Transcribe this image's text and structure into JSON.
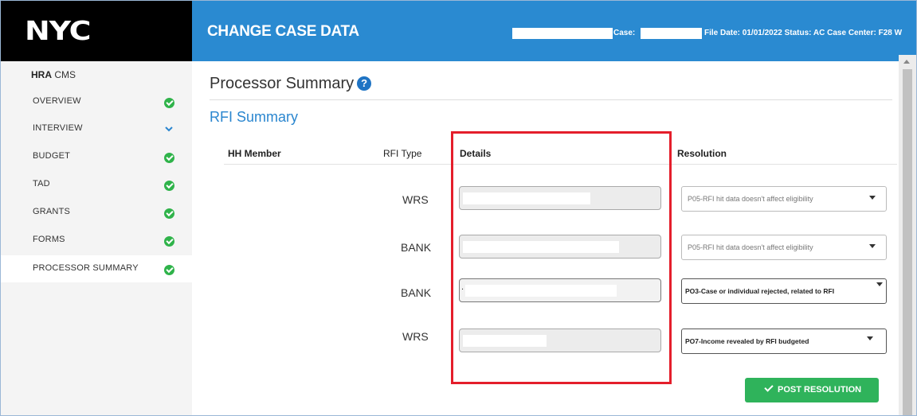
{
  "logo": {
    "text": "NYC"
  },
  "header": {
    "title": "CHANGE CASE DATA",
    "case_label": "Case:",
    "meta": "File Date: 01/01/2022 Status: AC Case Center: F28 W"
  },
  "sidebar": {
    "brand_bold": "HRA",
    "brand_rest": " CMS",
    "items": [
      {
        "label": "OVERVIEW",
        "status": "check-icon"
      },
      {
        "label": "INTERVIEW",
        "status": "chevron-down-icon"
      },
      {
        "label": "BUDGET",
        "status": "check-icon"
      },
      {
        "label": "TAD",
        "status": "check-icon"
      },
      {
        "label": "GRANTS",
        "status": "check-icon"
      },
      {
        "label": "FORMS",
        "status": "check-icon"
      },
      {
        "label": "PROCESSOR SUMMARY",
        "status": "check-icon"
      }
    ]
  },
  "main": {
    "title": "Processor Summary",
    "help_icon": "?",
    "section_title": "RFI Summary",
    "columns": {
      "hh_member": "HH Member",
      "rfi_type": "RFI Type",
      "details": "Details",
      "resolution": "Resolution"
    },
    "rows": [
      {
        "rfi_type": "WRS",
        "resolution": "P05-RFI hit data doesn't affect eligibility"
      },
      {
        "rfi_type": "BANK",
        "resolution": "P05-RFI hit data doesn't affect eligibility"
      },
      {
        "rfi_type": "BANK",
        "detail_value": ".",
        "resolution": "PO3-Case or individual rejected, related to RFI"
      },
      {
        "rfi_type": "WRS",
        "resolution": "PO7-Income revealed by RFI budgeted"
      }
    ],
    "post_button": "POST RESOLUTION"
  },
  "colors": {
    "header_blue": "#2a8ad1",
    "link_blue": "#2a86cf",
    "success_green": "#2fb35b",
    "highlight_red": "#e41e2b"
  }
}
